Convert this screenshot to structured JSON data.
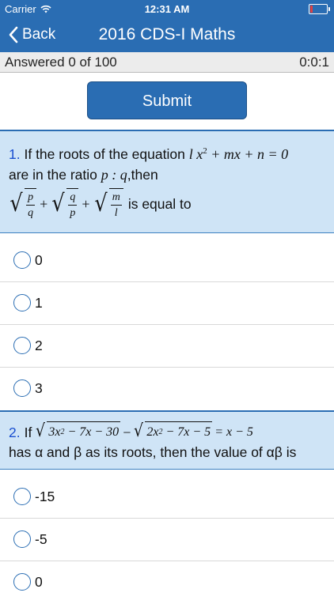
{
  "status_bar": {
    "carrier": "Carrier",
    "time": "12:31 AM",
    "icons": [
      "wifi-icon",
      "battery-icon"
    ]
  },
  "nav": {
    "back_label": "Back",
    "title": "2016 CDS-I Maths"
  },
  "progress": {
    "answered": "Answered 0 of 100",
    "timer": "0:0:1"
  },
  "submit_label": "Submit",
  "questions": [
    {
      "number": "1.",
      "text_1": "If the roots of the equation",
      "text_2": "are in the ratio",
      "text_3": ",then",
      "text_4": "is equal to",
      "math": {
        "equation": "lx² + mx + n = 0",
        "ratio": "p : q",
        "expression": "√(p/q) + √(q/p) + √(m/l)"
      },
      "options": [
        "0",
        "1",
        "2",
        "3"
      ]
    },
    {
      "number": "2.",
      "text_1": "If",
      "text_2": "has α and β as its roots, then the value of αβ is",
      "math": {
        "equation": "√(3x² − 7x − 30) − √(2x² − 7x − 5) = x − 5"
      },
      "options": [
        "-15",
        "-5",
        "0"
      ]
    }
  ],
  "colors": {
    "primary": "#2a6db3",
    "question_bg": "#cfe4f6",
    "question_number": "#1a4fd0"
  }
}
